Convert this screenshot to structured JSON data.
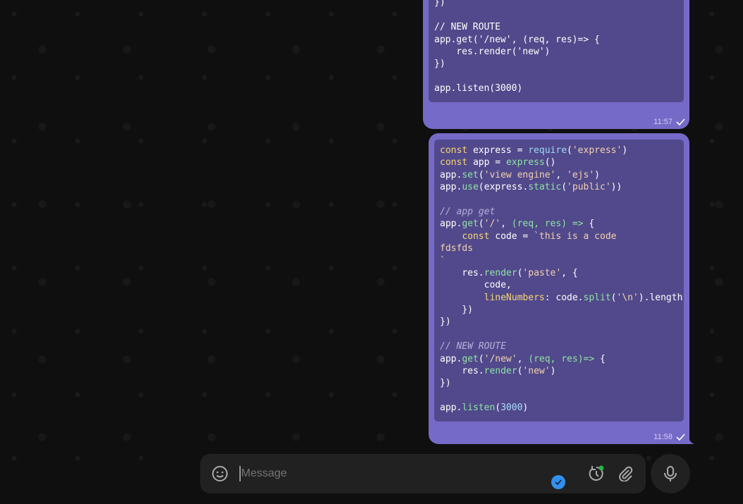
{
  "messages": [
    {
      "time": "11:57",
      "code": [
        [
          [
            "    });",
            "p"
          ]
        ],
        [
          [
            "})",
            "p"
          ]
        ],
        [
          [
            "",
            "p"
          ]
        ],
        [
          [
            "// NEW ROUTE",
            "p"
          ]
        ],
        [
          [
            "app.get('/new', (req, res)=> {",
            "p"
          ]
        ],
        [
          [
            "    res.render('new')",
            "p"
          ]
        ],
        [
          [
            "})",
            "p"
          ]
        ],
        [
          [
            "",
            "p"
          ]
        ],
        [
          [
            "app.listen(3000)",
            "p"
          ]
        ]
      ]
    },
    {
      "time": "11:58",
      "code": [
        [
          [
            "const",
            "k"
          ],
          [
            " express = ",
            "p"
          ],
          [
            "require",
            "b"
          ],
          [
            "(",
            "p"
          ],
          [
            "'express'",
            "s"
          ],
          [
            ")",
            "p"
          ]
        ],
        [
          [
            "const",
            "k"
          ],
          [
            " app = ",
            "p"
          ],
          [
            "express",
            "f"
          ],
          [
            "()",
            "p"
          ]
        ],
        [
          [
            "app.",
            "p"
          ],
          [
            "set",
            "f"
          ],
          [
            "(",
            "p"
          ],
          [
            "'view engine'",
            "s"
          ],
          [
            ", ",
            "p"
          ],
          [
            "'ejs'",
            "s"
          ],
          [
            ")",
            "p"
          ]
        ],
        [
          [
            "app.",
            "p"
          ],
          [
            "use",
            "f"
          ],
          [
            "(express.",
            "p"
          ],
          [
            "static",
            "f"
          ],
          [
            "(",
            "p"
          ],
          [
            "'public'",
            "s"
          ],
          [
            "))",
            "p"
          ]
        ],
        [
          [
            "",
            "p"
          ]
        ],
        [
          [
            "// app get",
            "c"
          ]
        ],
        [
          [
            "app.",
            "p"
          ],
          [
            "get",
            "f"
          ],
          [
            "(",
            "p"
          ],
          [
            "'/'",
            "s"
          ],
          [
            ", ",
            "p"
          ],
          [
            "(req, res) =>",
            "f"
          ],
          [
            " {",
            "p"
          ]
        ],
        [
          [
            "    ",
            "p"
          ],
          [
            "const",
            "k"
          ],
          [
            " code = ",
            "p"
          ],
          [
            "`this is a code",
            "s"
          ]
        ],
        [
          [
            "fdsfds",
            "s"
          ]
        ],
        [
          [
            "`",
            "s"
          ]
        ],
        [
          [
            "    res.",
            "p"
          ],
          [
            "render",
            "f"
          ],
          [
            "(",
            "p"
          ],
          [
            "'paste'",
            "s"
          ],
          [
            ", {",
            "p"
          ]
        ],
        [
          [
            "        code,",
            "p"
          ]
        ],
        [
          [
            "        ",
            "p"
          ],
          [
            "lineNumbers",
            "k"
          ],
          [
            ": code.",
            "p"
          ],
          [
            "split",
            "f"
          ],
          [
            "(",
            "p"
          ],
          [
            "'\\n'",
            "s"
          ],
          [
            ").length",
            "p"
          ]
        ],
        [
          [
            "    })",
            "p"
          ]
        ],
        [
          [
            "})",
            "p"
          ]
        ],
        [
          [
            "",
            "p"
          ]
        ],
        [
          [
            "// NEW ROUTE",
            "c"
          ]
        ],
        [
          [
            "app.",
            "p"
          ],
          [
            "get",
            "f"
          ],
          [
            "(",
            "p"
          ],
          [
            "'/new'",
            "s"
          ],
          [
            ", ",
            "p"
          ],
          [
            "(req, res)=>",
            "f"
          ],
          [
            " {",
            "p"
          ]
        ],
        [
          [
            "    res.",
            "p"
          ],
          [
            "render",
            "f"
          ],
          [
            "(",
            "p"
          ],
          [
            "'new'",
            "s"
          ],
          [
            ")",
            "p"
          ]
        ],
        [
          [
            "})",
            "p"
          ]
        ],
        [
          [
            "",
            "p"
          ]
        ],
        [
          [
            "app.",
            "p"
          ],
          [
            "listen",
            "f"
          ],
          [
            "(",
            "p"
          ],
          [
            "3000",
            "n"
          ],
          [
            ")",
            "p"
          ]
        ]
      ]
    }
  ],
  "composer": {
    "placeholder": "Message",
    "value": ""
  },
  "icons": {
    "emoji": "smiley-icon",
    "schedule": "timer-icon",
    "attach": "paperclip-icon",
    "mic": "microphone-icon",
    "status": "checkmark-badge-icon"
  },
  "colors": {
    "bubble": "#766ac8",
    "code_bg": "#51498b",
    "online_dot": "#2bb34a",
    "badge": "#3390ec"
  }
}
